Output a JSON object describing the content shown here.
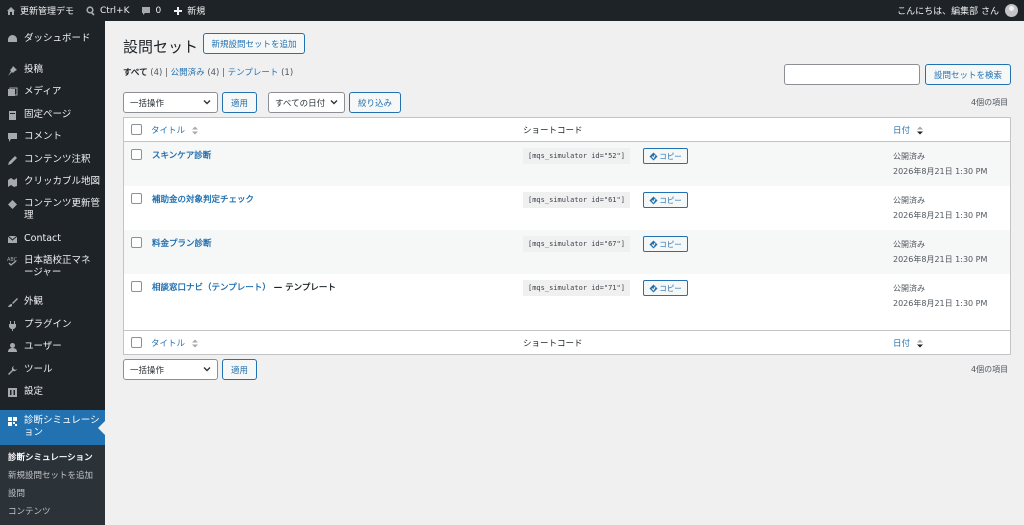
{
  "adminbar": {
    "site_name": "更新管理デモ",
    "shortcut": "Ctrl+K",
    "comments_count": "0",
    "new_label": "新規",
    "greeting": "こんにちは、編集部 さん"
  },
  "sidebar": {
    "items": [
      {
        "label": "ダッシュボード",
        "icon": "dashboard-icon"
      },
      {
        "label": "投稿",
        "icon": "pin-icon"
      },
      {
        "label": "メディア",
        "icon": "media-icon"
      },
      {
        "label": "固定ページ",
        "icon": "page-icon"
      },
      {
        "label": "コメント",
        "icon": "comment-icon"
      },
      {
        "label": "コンテンツ注釈",
        "icon": "pencil-icon"
      },
      {
        "label": "クリッカブル地図",
        "icon": "map-icon"
      },
      {
        "label": "コンテンツ更新管理",
        "label2": "理",
        "icon": "tag-icon"
      },
      {
        "label": "Contact",
        "icon": "mail-icon"
      },
      {
        "label": "日本語校正マネー",
        "label2": "ジャー",
        "icon": "spellcheck-icon"
      },
      {
        "label": "外観",
        "icon": "brush-icon"
      },
      {
        "label": "プラグイン",
        "icon": "plugin-icon"
      },
      {
        "label": "ユーザー",
        "icon": "user-icon"
      },
      {
        "label": "ツール",
        "icon": "wrench-icon"
      },
      {
        "label": "設定",
        "icon": "settings-icon"
      },
      {
        "label": "診断シミュレーシ",
        "label2": "ョン",
        "icon": "qr-icon"
      }
    ],
    "submenu": [
      "診断シミュレーション",
      "新規設問セットを追加",
      "設問",
      "コンテンツ"
    ]
  },
  "page": {
    "title": "設問セット",
    "add_new": "新規設問セットを追加",
    "filters": {
      "all": "すべて",
      "all_count": "(4)",
      "published": "公開済み",
      "published_count": "(4)",
      "template": "テンプレート",
      "template_count": "(1)"
    },
    "search_button": "設問セットを検索",
    "bulk_action": "一括操作",
    "apply": "適用",
    "all_dates": "すべての日付",
    "filter_button": "絞り込み",
    "items_count": "4個の項目"
  },
  "table": {
    "col_title": "タイトル",
    "col_shortcode": "ショートコード",
    "col_date": "日付",
    "copy_label": "コピー",
    "rows": [
      {
        "title": "スキンケア診断",
        "state": "",
        "shortcode": "[mqs_simulator id=\"52\"]",
        "status": "公開済み",
        "date": "2026年8月21日 1:30 PM"
      },
      {
        "title": "補助金の対象判定チェック",
        "state": "",
        "shortcode": "[mqs_simulator id=\"61\"]",
        "status": "公開済み",
        "date": "2026年8月21日 1:30 PM"
      },
      {
        "title": "料金プラン診断",
        "state": "",
        "shortcode": "[mqs_simulator id=\"67\"]",
        "status": "公開済み",
        "date": "2026年8月21日 1:30 PM"
      },
      {
        "title": "相談窓口ナビ（テンプレート）",
        "state": "— テンプレート",
        "shortcode": "[mqs_simulator id=\"71\"]",
        "status": "公開済み",
        "date": "2026年8月21日 1:30 PM"
      }
    ]
  }
}
